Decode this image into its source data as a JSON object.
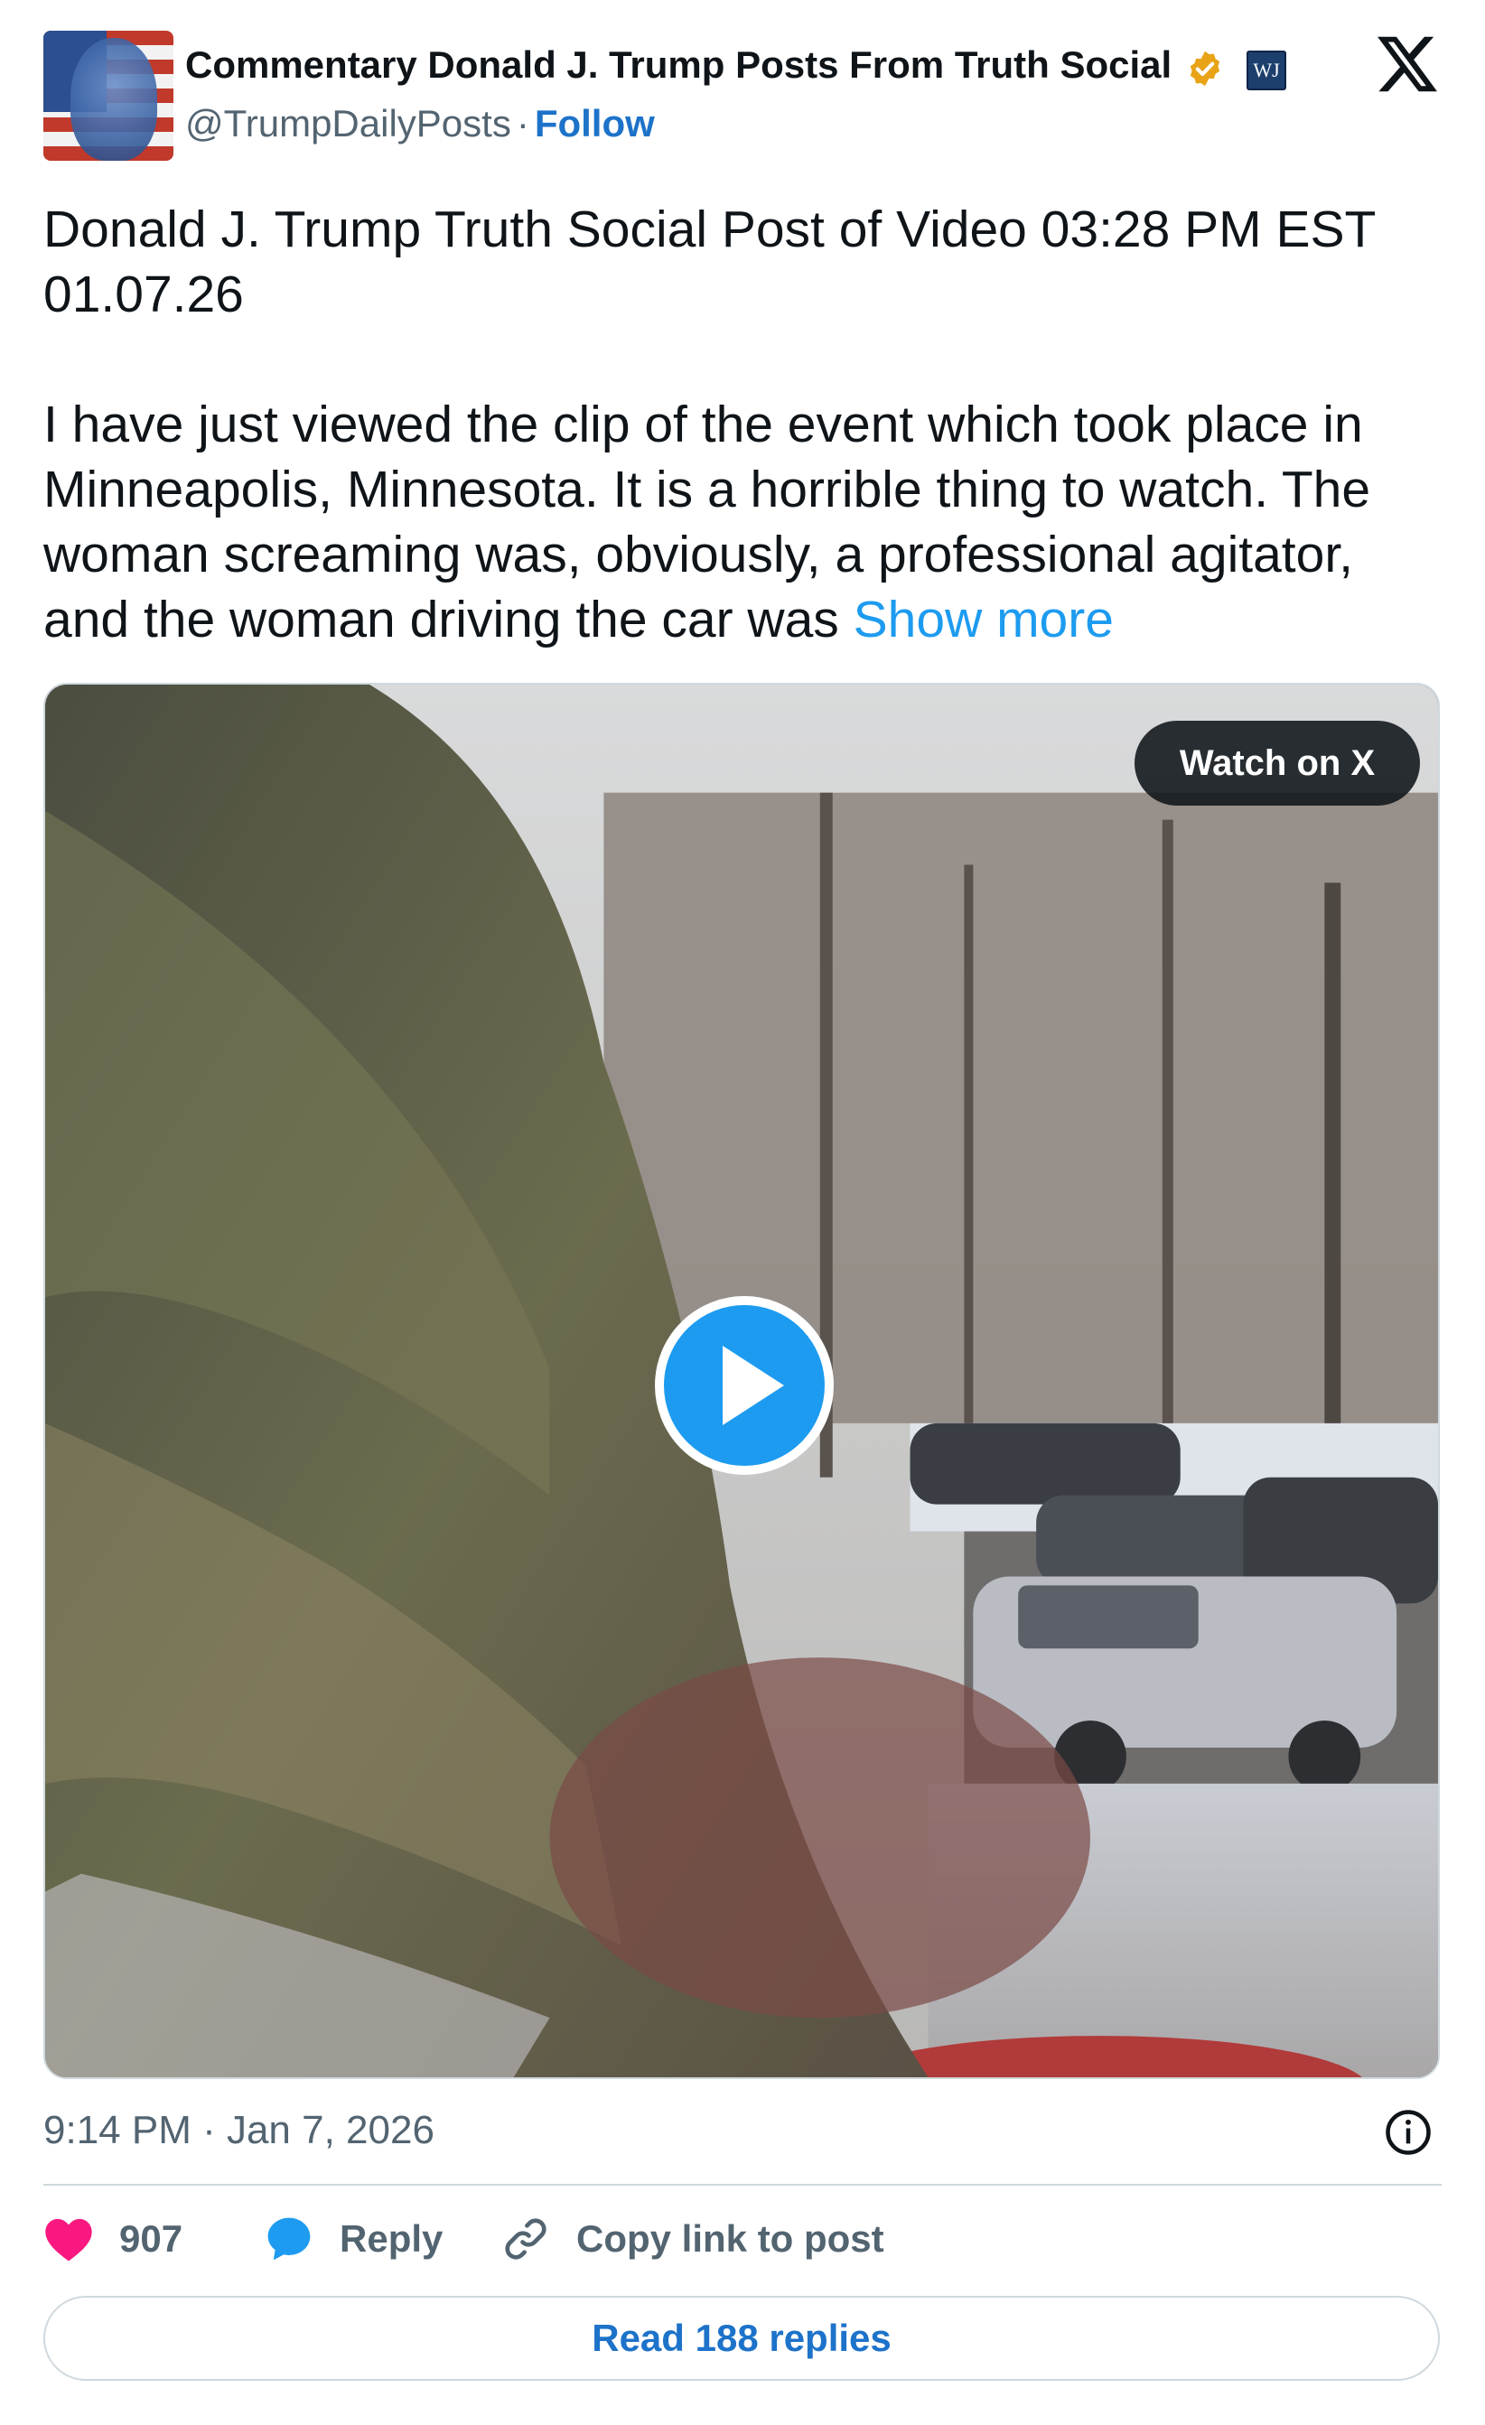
{
  "author": {
    "display_name": "Commentary Donald J. Trump Posts From Truth Social",
    "handle": "@TrumpDailyPosts",
    "separator": "·",
    "follow_label": "Follow",
    "badge_text": "WJ",
    "verified_color": "#e8a317"
  },
  "post": {
    "headline_line1": "Donald J. Trump Truth Social Post of Video 03:28 PM EST",
    "headline_line2": "01.07.26",
    "body": "I have just viewed the clip of the event which took place in Minneapolis, Minnesota. It is a horrible thing to watch. The woman screaming was, obviously, a professional agitator, and the woman driving the car was",
    "show_more_label": "Show more"
  },
  "media": {
    "watch_label": "Watch on X",
    "play_icon": "play-icon"
  },
  "meta": {
    "timestamp": "9:14 PM · Jan 7, 2026"
  },
  "actions": {
    "likes": "907",
    "reply_label": "Reply",
    "copy_label": "Copy link to post"
  },
  "footer": {
    "read_replies_label": "Read 188 replies"
  },
  "colors": {
    "link": "#1d9bf0",
    "like": "#f91880",
    "muted": "#536471",
    "border": "#cfd9de"
  }
}
